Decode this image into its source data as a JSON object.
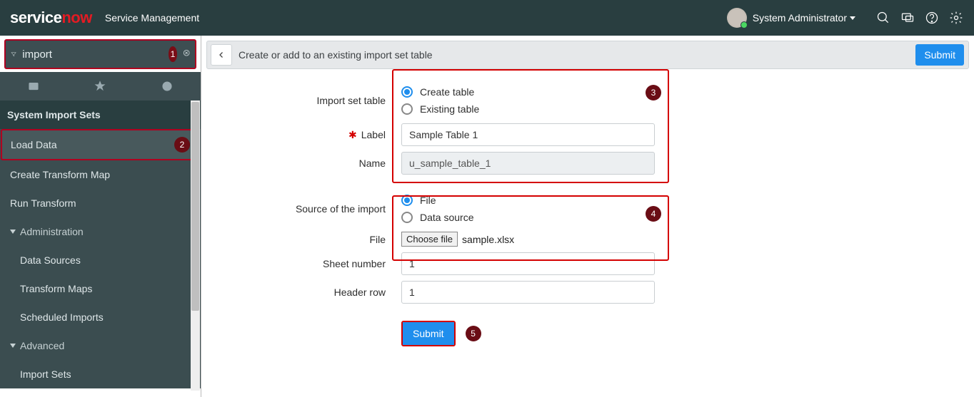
{
  "brand": {
    "service": "service",
    "now": "now",
    "sub": "Service Management"
  },
  "user": {
    "name": "System Administrator"
  },
  "filter": {
    "value": "import",
    "placeholder": ""
  },
  "badges": {
    "b1": "1",
    "b2": "2",
    "b3": "3",
    "b4": "4",
    "b5": "5"
  },
  "nav": {
    "header": "System Import Sets",
    "items": {
      "loadData": "Load Data",
      "createTransform": "Create Transform Map",
      "runTransform": "Run Transform",
      "admin": "Administration",
      "dataSources": "Data Sources",
      "transformMaps": "Transform Maps",
      "scheduledImports": "Scheduled Imports",
      "advanced": "Advanced",
      "importSets": "Import Sets"
    }
  },
  "header": {
    "title": "Create or add to an existing import set table",
    "submit": "Submit"
  },
  "form": {
    "importSetLabel": "Import set table",
    "createTable": "Create table",
    "existingTable": "Existing table",
    "labelLabel": "Label",
    "labelValue": "Sample Table 1",
    "nameLabel": "Name",
    "nameValue": "u_sample_table_1",
    "sourceLabel": "Source of the import",
    "fileOpt": "File",
    "dataSourceOpt": "Data source",
    "fileLabel": "File",
    "chooseFile": "Choose file",
    "fileName": "sample.xlsx",
    "sheetLabel": "Sheet number",
    "sheetValue": "1",
    "headerRowLabel": "Header row",
    "headerRowValue": "1",
    "submit": "Submit"
  }
}
